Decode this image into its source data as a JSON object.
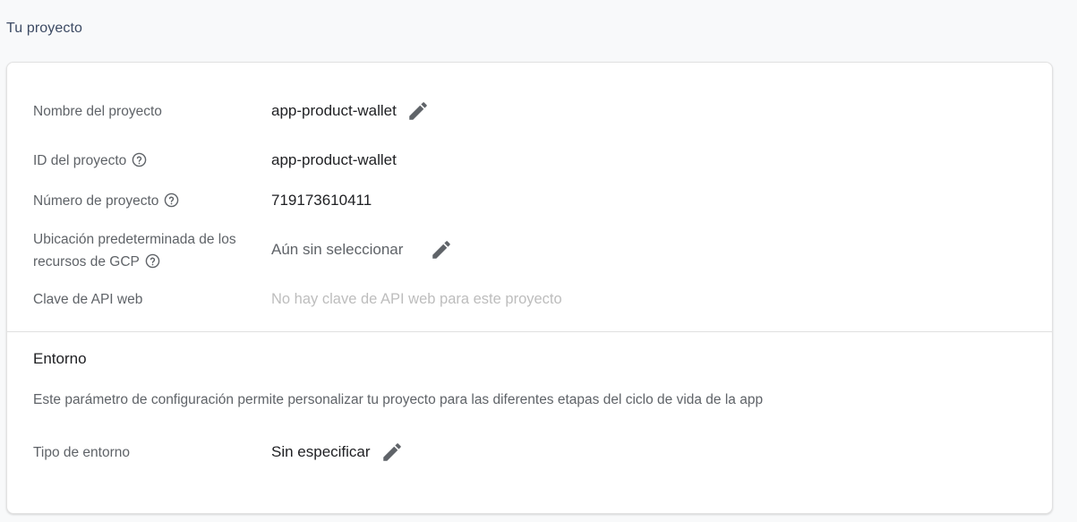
{
  "page": {
    "title": "Tu proyecto"
  },
  "project": {
    "name_label": "Nombre del proyecto",
    "name_value": "app-product-wallet",
    "id_label": "ID del proyecto",
    "id_value": "app-product-wallet",
    "number_label": "Número de proyecto",
    "number_value": "719173610411",
    "location_label_line1": "Ubicación predeterminada de los",
    "location_label_line2": "recursos de GCP",
    "location_value": "Aún sin seleccionar",
    "api_key_label": "Clave de API web",
    "api_key_value": "No hay clave de API web para este proyecto"
  },
  "environment": {
    "title": "Entorno",
    "description": "Este parámetro de configuración permite personalizar tu proyecto para las diferentes etapas del ciclo de vida de la app",
    "type_label": "Tipo de entorno",
    "type_value": "Sin especificar"
  },
  "icons": {
    "edit": "pencil-icon",
    "help": "help-circle-icon"
  },
  "colors": {
    "background": "#f8f9fa",
    "title": "#3c4a63",
    "label": "#5f6368",
    "value": "#202124",
    "disabled": "#bdbdbd",
    "icon": "#5f6368"
  }
}
